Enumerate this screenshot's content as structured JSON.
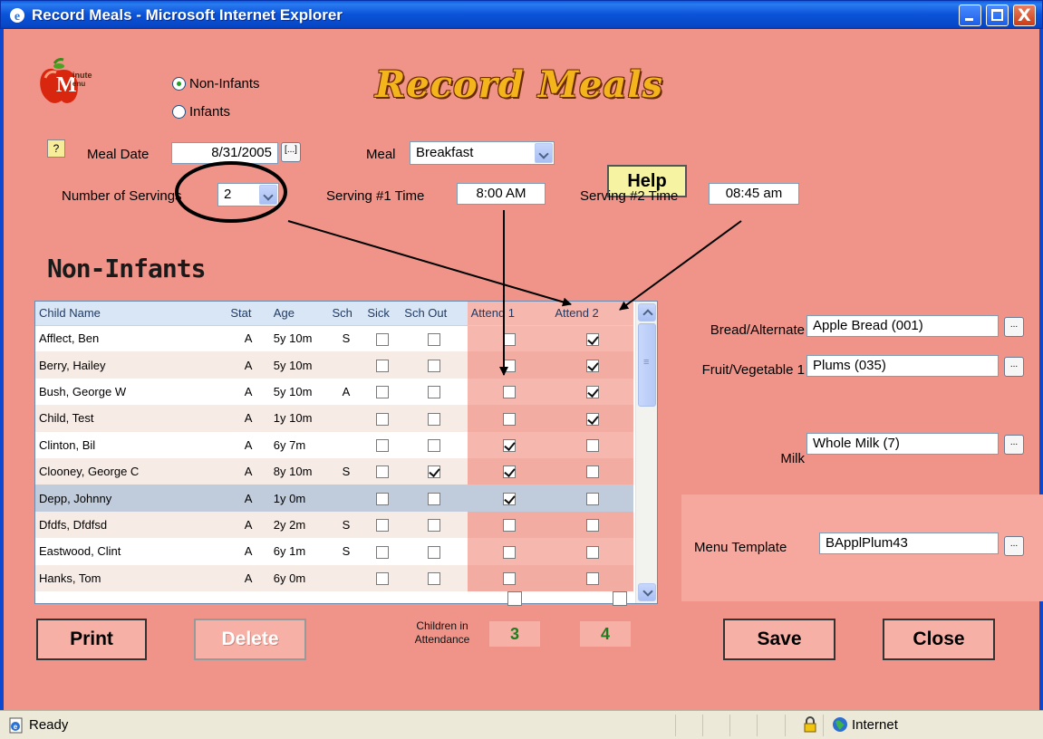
{
  "window": {
    "title": "Record Meals - Microsoft Internet Explorer",
    "min_glyph": "",
    "close_glyph": "X"
  },
  "header": {
    "logo_text_1": "inute",
    "logo_text_2": "enu",
    "page_title": "Record Meals",
    "radio_non_infants": "Non-Infants",
    "radio_infants": "Infants",
    "selected_group": "Non-Infants"
  },
  "form": {
    "help_small": "?",
    "meal_date_label": "Meal Date",
    "meal_date_value": "8/31/2005",
    "date_picker_label": "[...]",
    "meal_label": "Meal",
    "meal_value": "Breakfast",
    "help_label": "Help",
    "servings_label": "Number of Servings",
    "servings_value": "2",
    "serving1_label": "Serving #1 Time",
    "serving1_value": "8:00 AM",
    "serving2_label": "Serving #2 Time",
    "serving2_value": "08:45 am"
  },
  "section_title": "Non-Infants",
  "table": {
    "columns": [
      "Child Name",
      "Stat",
      "Age",
      "Sch",
      "Sick",
      "Sch Out",
      "Attend 1",
      "Attend 2"
    ],
    "rows": [
      {
        "name": "Afflect, Ben",
        "stat": "A",
        "age": "5y 10m",
        "sch": "S",
        "sick": false,
        "schout": false,
        "att1": false,
        "att2": true
      },
      {
        "name": "Berry, Hailey",
        "stat": "A",
        "age": "5y 10m",
        "sch": "",
        "sick": false,
        "schout": false,
        "att1": false,
        "att2": true
      },
      {
        "name": "Bush, George W",
        "stat": "A",
        "age": "5y 10m",
        "sch": "A",
        "sick": false,
        "schout": false,
        "att1": false,
        "att2": true
      },
      {
        "name": "Child, Test",
        "stat": "A",
        "age": "1y 10m",
        "sch": "",
        "sick": false,
        "schout": false,
        "att1": false,
        "att2": true
      },
      {
        "name": "Clinton, Bil",
        "stat": "A",
        "age": "6y 7m",
        "sch": "",
        "sick": false,
        "schout": false,
        "att1": true,
        "att2": false
      },
      {
        "name": "Clooney, George C",
        "stat": "A",
        "age": "8y 10m",
        "sch": "S",
        "sick": false,
        "schout": true,
        "att1": true,
        "att2": false
      },
      {
        "name": "Depp, Johnny",
        "stat": "A",
        "age": "1y 0m",
        "sch": "",
        "sick": false,
        "schout": false,
        "att1": true,
        "att2": false
      },
      {
        "name": "Dfdfs, Dfdfsd",
        "stat": "A",
        "age": "2y 2m",
        "sch": "S",
        "sick": false,
        "schout": false,
        "att1": false,
        "att2": false
      },
      {
        "name": "Eastwood, Clint",
        "stat": "A",
        "age": "6y 1m",
        "sch": "S",
        "sick": false,
        "schout": false,
        "att1": false,
        "att2": false
      },
      {
        "name": "Hanks, Tom",
        "stat": "A",
        "age": "6y 0m",
        "sch": "",
        "sick": false,
        "schout": false,
        "att1": false,
        "att2": false
      }
    ]
  },
  "menu": {
    "bread_label": "Bread/Alternate",
    "bread_value": "Apple Bread (001)",
    "fruit_label": "Fruit/Vegetable 1",
    "fruit_value": "Plums (035)",
    "milk_label": "Milk",
    "milk_value": "Whole Milk (7)",
    "template_label": "Menu Template",
    "template_value": "BApplPlum43",
    "browse_label": "..."
  },
  "footer": {
    "print_label": "Print",
    "delete_label": "Delete",
    "attendance_label_1": "Children in",
    "attendance_label_2": "Attendance",
    "attend1_count": "3",
    "attend2_count": "4",
    "save_label": "Save",
    "close_label": "Close"
  },
  "status": {
    "text": "Ready",
    "zone": "Internet"
  }
}
